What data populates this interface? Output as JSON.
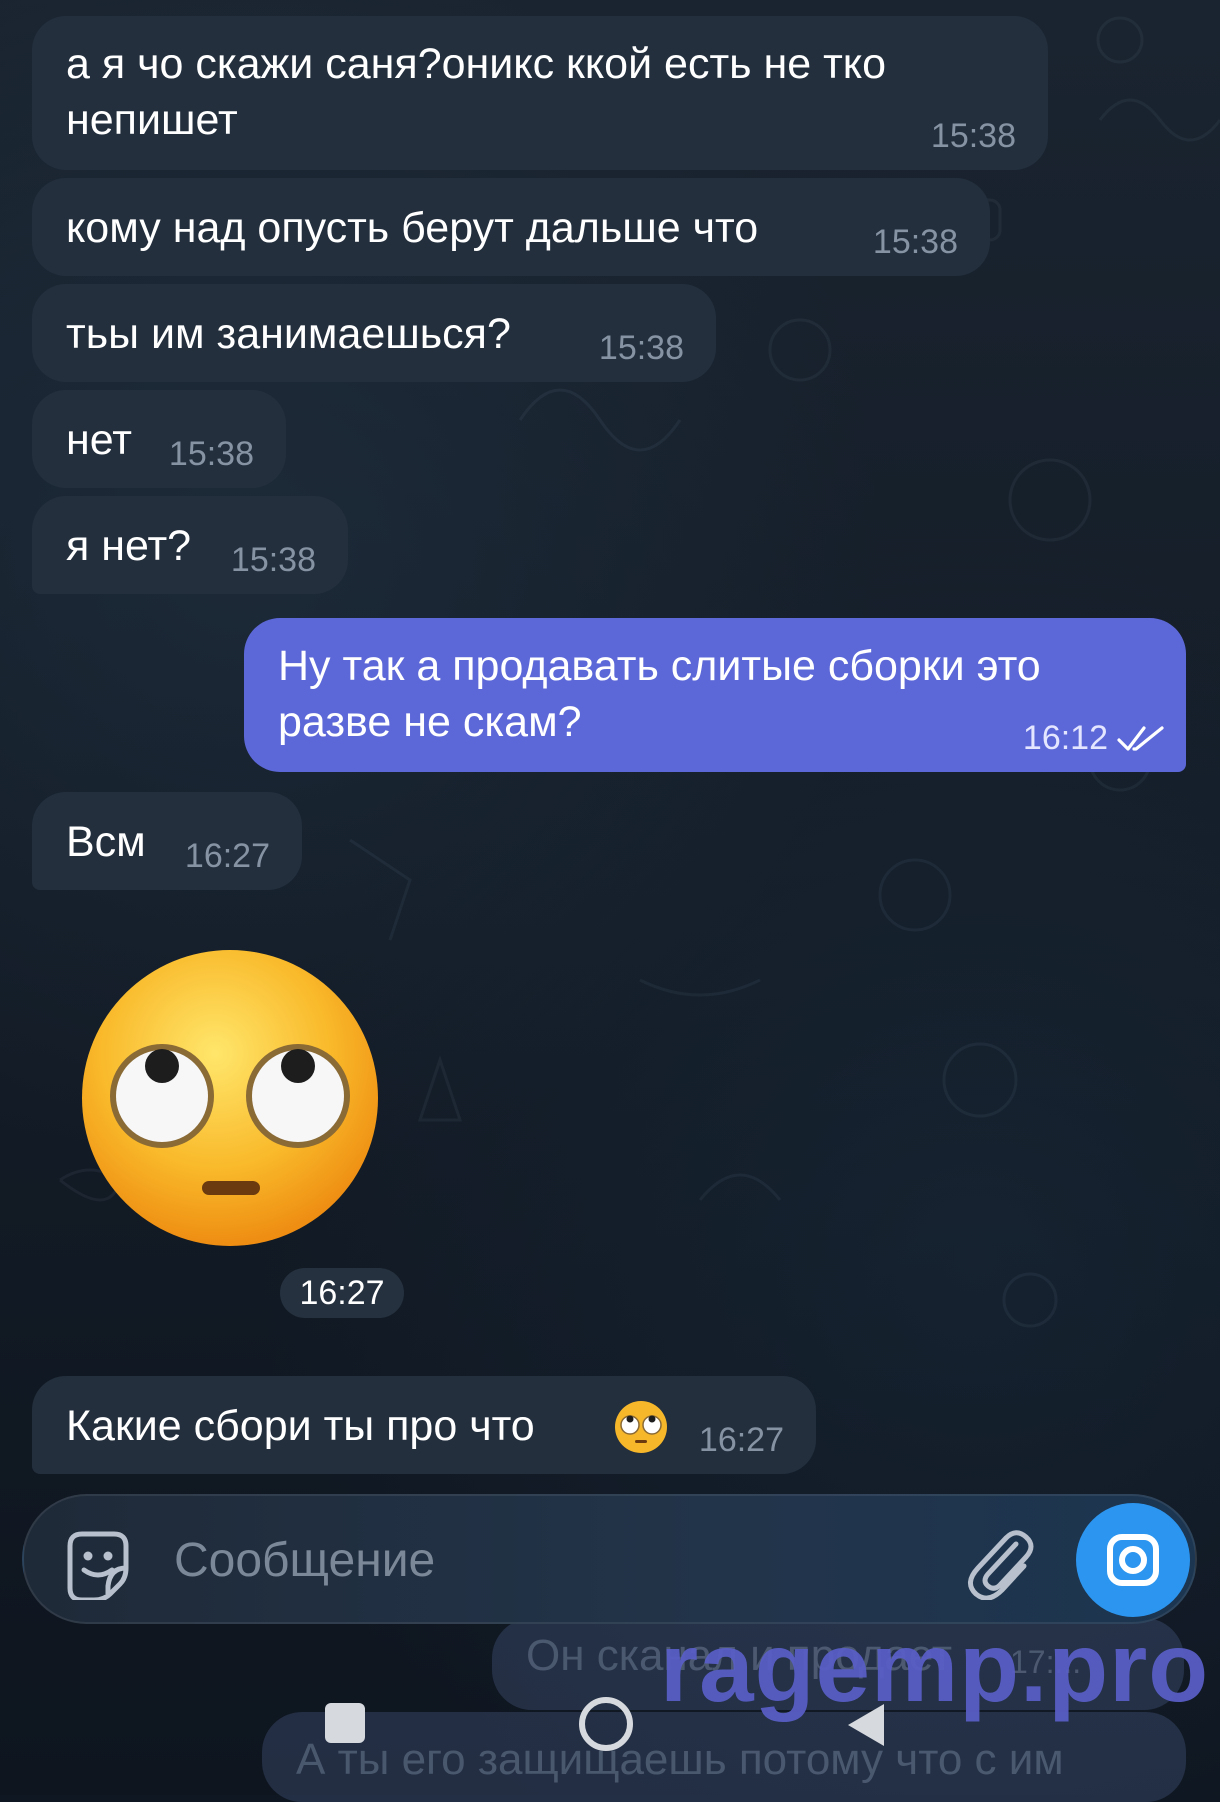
{
  "messages": [
    {
      "text": "а я чо скажи саня?оникс ккой есть не тко непишет",
      "time": "15:38",
      "direction": "in"
    },
    {
      "text": "кому над опусть берут дальше что",
      "time": "15:38",
      "direction": "in"
    },
    {
      "text": "тьы им занимаешься?",
      "time": "15:38",
      "direction": "in"
    },
    {
      "text": "нет",
      "time": "15:38",
      "direction": "in"
    },
    {
      "text": "я нет?",
      "time": "15:38",
      "direction": "in"
    },
    {
      "text": "Ну так а продавать слитые сборки это разве не скам?",
      "time": "16:12",
      "direction": "out",
      "status": "read"
    },
    {
      "text": "Всм",
      "time": "16:27",
      "direction": "in"
    },
    {
      "text": "Какие сбори ты про что",
      "time": "16:27",
      "direction": "in",
      "trailing_emoji": "face-with-rolling-eyes"
    }
  ],
  "sticker": {
    "emoji": "face-with-rolling-eyes",
    "time": "16:27"
  },
  "composer": {
    "placeholder": "Сообщение"
  },
  "background_messages": [
    {
      "text": "Он сканал и продает",
      "time": "17:..."
    },
    {
      "text": "А ты его защищаешь потому что с им"
    }
  ],
  "watermark": "ragemp.pro",
  "colors": {
    "incoming_bubble": "#232f3d",
    "outgoing_bubble": "#5d68d8",
    "camera_button": "#2b95ef"
  }
}
